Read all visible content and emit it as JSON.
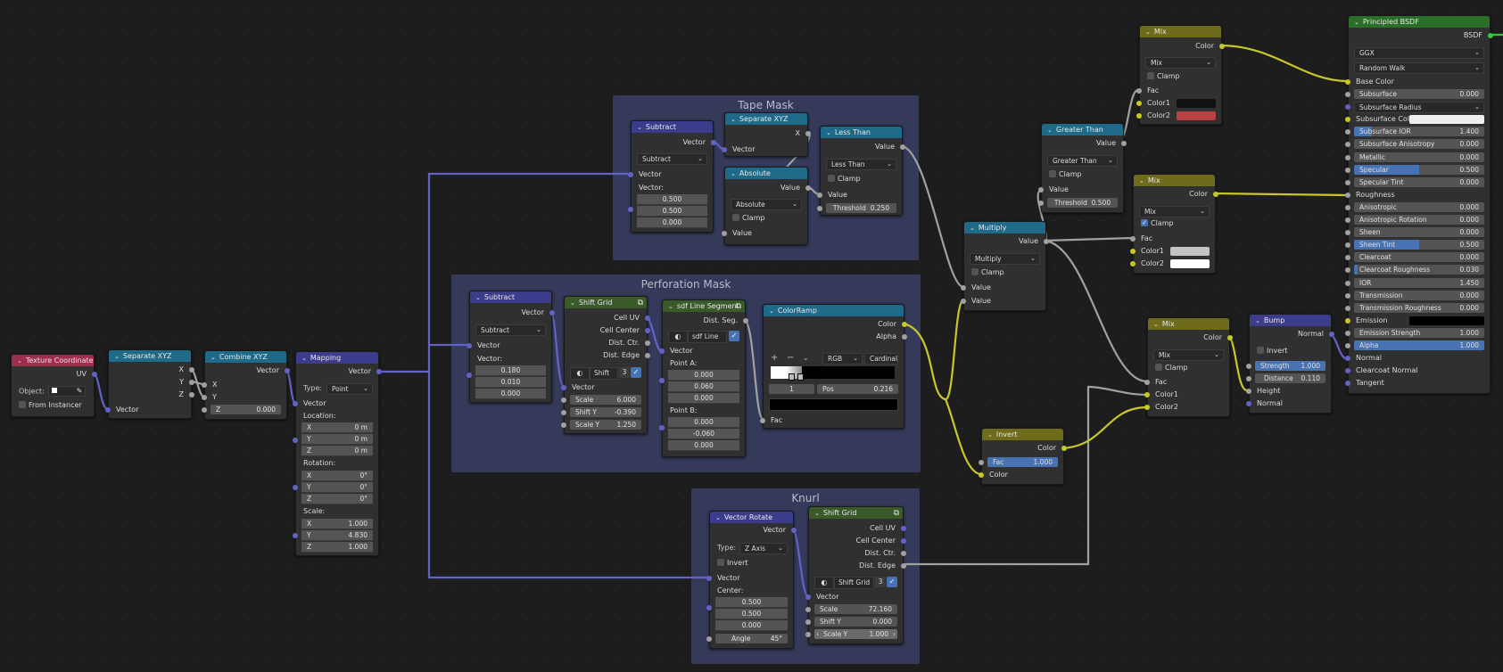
{
  "app": "Blender Shader Editor",
  "frames": {
    "tape_mask": "Tape Mask",
    "perforation_mask": "Perforation Mask",
    "knurl": "Knurl"
  },
  "nodes": {
    "texcoord": {
      "title": "Texture Coordinate",
      "out_uv": "UV",
      "object_label": "Object:",
      "from_instancer": "From Instancer"
    },
    "sepxyz1": {
      "title": "Separate XYZ",
      "out": [
        "X",
        "Y",
        "Z"
      ],
      "in_vector": "Vector"
    },
    "combxyz": {
      "title": "Combine XYZ",
      "out_vector": "Vector",
      "in_x": "X",
      "in_y": "Y",
      "z_label": "Z",
      "z_value": "0.000"
    },
    "mapping": {
      "title": "Mapping",
      "out_vector": "Vector",
      "type_label": "Type:",
      "type_value": "Point",
      "in_vector": "Vector",
      "location_label": "Location:",
      "location": [
        {
          "a": "X",
          "v": "0 m"
        },
        {
          "a": "Y",
          "v": "0 m"
        },
        {
          "a": "Z",
          "v": "0 m"
        }
      ],
      "rotation_label": "Rotation:",
      "rotation": [
        {
          "a": "X",
          "v": "0°"
        },
        {
          "a": "Y",
          "v": "0°"
        },
        {
          "a": "Z",
          "v": "0°"
        }
      ],
      "scale_label": "Scale:",
      "scale": [
        {
          "a": "X",
          "v": "1.000"
        },
        {
          "a": "Y",
          "v": "4.830"
        },
        {
          "a": "Z",
          "v": "1.000"
        }
      ]
    },
    "tape_subtract": {
      "title": "Subtract",
      "out_vector": "Vector",
      "op": "Subtract",
      "in_vector": "Vector",
      "vec_label": "Vector:",
      "values": [
        "0.500",
        "0.500",
        "0.000"
      ]
    },
    "tape_sepxyz": {
      "title": "Separate XYZ",
      "out_x": "X",
      "in_vector": "Vector"
    },
    "tape_absolute": {
      "title": "Absolute",
      "out_value": "Value",
      "op": "Absolute",
      "clamp": "Clamp",
      "in_value": "Value"
    },
    "tape_lessthan": {
      "title": "Less Than",
      "out_value": "Value",
      "op": "Less Than",
      "clamp": "Clamp",
      "in_value": "Value",
      "threshold_label": "Threshold",
      "threshold_value": "0.250"
    },
    "perf_subtract": {
      "title": "Subtract",
      "out_vector": "Vector",
      "op": "Subtract",
      "in_vector": "Vector",
      "vec_label": "Vector:",
      "values": [
        "0.180",
        "0.010",
        "0.000"
      ]
    },
    "perf_shiftgrid": {
      "title": "Shift Grid",
      "outs": [
        "Cell UV",
        "Cell Center",
        "Dist. Ctr.",
        "Dist.  Edge"
      ],
      "datablock": "Shift ...",
      "users": "3",
      "in_vector": "Vector",
      "fields": [
        {
          "l": "Scale",
          "v": "6.000"
        },
        {
          "l": "Shift Y",
          "v": "-0.390"
        },
        {
          "l": "Scale Y",
          "v": "1.250"
        }
      ]
    },
    "perf_sdf": {
      "title": "sdf Line Segment",
      "out": "Dist. Seg.",
      "datablock": "sdf Line Se...",
      "in_vector": "Vector",
      "point_a_label": "Point A:",
      "point_a": [
        "0.000",
        "0.060",
        "0.000"
      ],
      "point_b_label": "Point B:",
      "point_b": [
        "0.000",
        "-0.060",
        "0.000"
      ]
    },
    "colorramp": {
      "title": "ColorRamp",
      "out_color": "Color",
      "out_alpha": "Alpha",
      "color_mode": "RGB",
      "interpolation": "Cardinal",
      "stop_index": "1",
      "pos_label": "Pos",
      "pos_value": "0.216",
      "in_fac": "Fac",
      "stop_color": "#000000"
    },
    "knurl_rotate": {
      "title": "Vector Rotate",
      "out_vector": "Vector",
      "type_label": "Type:",
      "type_value": "Z Axis",
      "invert": "Invert",
      "in_vector": "Vector",
      "center_label": "Center:",
      "center": [
        "0.500",
        "0.500",
        "0.000"
      ],
      "angle_label": "Angle",
      "angle_value": "45°"
    },
    "knurl_shiftgrid": {
      "title": "Shift Grid",
      "outs": [
        "Cell UV",
        "Cell Center",
        "Dist. Ctr.",
        "Dist.  Edge"
      ],
      "datablock": "Shift Grid",
      "users": "3",
      "in_vector": "Vector",
      "fields": [
        {
          "l": "Scale",
          "v": "72.160"
        },
        {
          "l": "Shift Y",
          "v": "0.000"
        },
        {
          "l": "Scale Y",
          "v": "1.000"
        }
      ]
    },
    "multiply": {
      "title": "Multiply",
      "out_value": "Value",
      "op": "Multiply",
      "clamp": "Clamp",
      "in1": "Value",
      "in2": "Value"
    },
    "greaterthan": {
      "title": "Greater Than",
      "out_value": "Value",
      "op": "Greater Than",
      "clamp": "Clamp",
      "in_value": "Value",
      "threshold_label": "Threshold",
      "threshold_value": "0.500"
    },
    "mix1": {
      "title": "Mix",
      "out_color": "Color",
      "blend": "Mix",
      "clamp": "Clamp",
      "clamp_on": false,
      "fac": "Fac",
      "color1": "Color1",
      "color2": "Color2",
      "color1_hex": "#111111",
      "color2_hex": "#b84040"
    },
    "mix2": {
      "title": "Mix",
      "out_color": "Color",
      "blend": "Mix",
      "clamp": "Clamp",
      "clamp_on": true,
      "fac": "Fac",
      "color1": "Color1",
      "color2": "Color2",
      "color1_hex": "#c4c4c4",
      "color2_hex": "#ffffff"
    },
    "invert": {
      "title": "Invert",
      "out_color": "Color",
      "fac_label": "Fac",
      "fac_value": "1.000",
      "in_color": "Color"
    },
    "mix3": {
      "title": "Mix",
      "out_color": "Color",
      "blend": "Mix",
      "clamp": "Clamp",
      "fac": "Fac",
      "color1": "Color1",
      "color2": "Color2"
    },
    "bump": {
      "title": "Bump",
      "out_normal": "Normal",
      "invert": "Invert",
      "strength_label": "Strength",
      "strength_value": "1.000",
      "distance_label": "Distance",
      "distance_value": "0.110",
      "in_height": "Height",
      "in_normal": "Normal"
    },
    "bsdf": {
      "title": "Principled BSDF",
      "out": "BSDF",
      "distribution": "GGX",
      "subsurface_method": "Random Walk",
      "base_color": "Base Color",
      "rows": [
        {
          "l": "Subsurface",
          "v": "0.000",
          "fill": 0
        },
        {
          "l": "Subsurface Radius",
          "v": "",
          "dd": true
        },
        {
          "l": "Subsurface Color",
          "v": "",
          "swatch": "#f0f0f0"
        },
        {
          "l": "Subsurface IOR",
          "v": "1.400",
          "fill": 0.14
        },
        {
          "l": "Subsurface Anisotropy",
          "v": "0.000",
          "fill": 0
        },
        {
          "l": "Metallic",
          "v": "0.000",
          "fill": 0
        },
        {
          "l": "Specular",
          "v": "0.500",
          "fill": 0.5
        },
        {
          "l": "Specular Tint",
          "v": "0.000",
          "fill": 0
        },
        {
          "l": "Roughness",
          "v": "",
          "plain": true
        },
        {
          "l": "Anisotropic",
          "v": "0.000",
          "fill": 0
        },
        {
          "l": "Anisotropic Rotation",
          "v": "0.000",
          "fill": 0
        },
        {
          "l": "Sheen",
          "v": "0.000",
          "fill": 0
        },
        {
          "l": "Sheen Tint",
          "v": "0.500",
          "fill": 0.5
        },
        {
          "l": "Clearcoat",
          "v": "0.000",
          "fill": 0
        },
        {
          "l": "Clearcoat Roughness",
          "v": "0.030",
          "fill": 0.03
        },
        {
          "l": "IOR",
          "v": "1.450",
          "fill": 0
        },
        {
          "l": "Transmission",
          "v": "0.000",
          "fill": 0
        },
        {
          "l": "Transmission Roughness",
          "v": "0.000",
          "fill": 0
        },
        {
          "l": "Emission",
          "v": "",
          "swatch": "#000000"
        },
        {
          "l": "Emission Strength",
          "v": "1.000",
          "fill": 0
        },
        {
          "l": "Alpha",
          "v": "1.000",
          "fill": 1.0
        }
      ],
      "vector_inputs": [
        "Normal",
        "Clearcoat Normal",
        "Tangent"
      ]
    }
  },
  "colors": {
    "vector_socket": "#6363c7",
    "value_socket": "#a1a1a1",
    "color_socket": "#c7c729",
    "shader_socket": "#35c735",
    "frame": "#353a5a",
    "accent": "#4772b3"
  }
}
